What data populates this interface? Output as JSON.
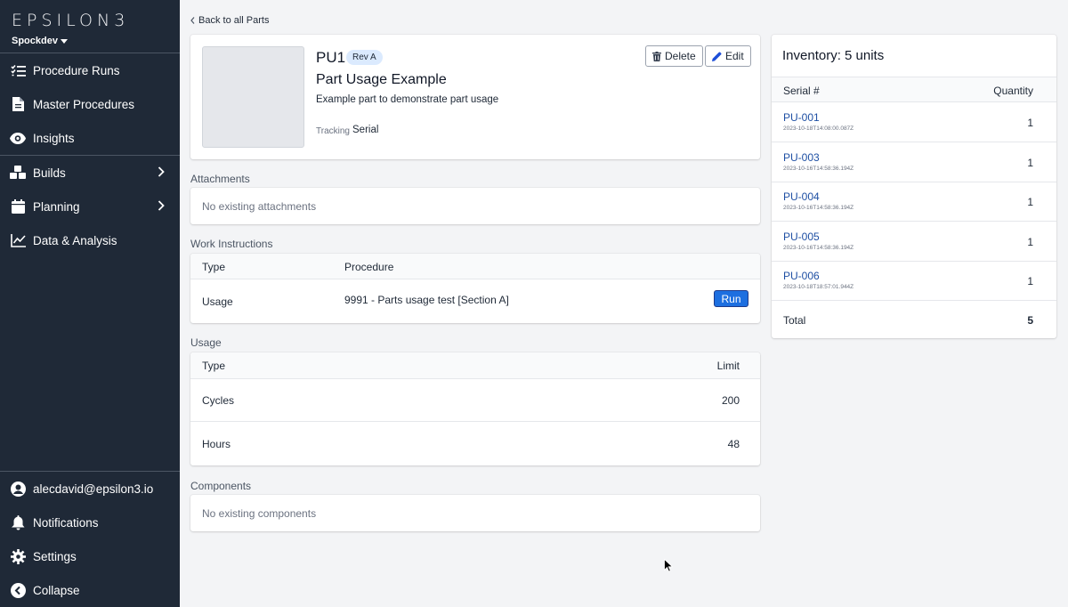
{
  "sidebar": {
    "logo": "EPSILON3",
    "workspace": "Spockdev",
    "items": [
      {
        "label": "Procedure Runs",
        "icon": "checklist-icon"
      },
      {
        "label": "Master Procedures",
        "icon": "document-icon"
      },
      {
        "label": "Insights",
        "icon": "eye-icon"
      },
      {
        "label": "Builds",
        "icon": "cubes-icon"
      },
      {
        "label": "Planning",
        "icon": "calendar-icon"
      },
      {
        "label": "Data & Analysis",
        "icon": "chart-line-icon"
      }
    ],
    "bottom_items": [
      {
        "label": "alecdavid@epsilon3.io",
        "icon": "user-circle-icon"
      },
      {
        "label": "Notifications",
        "icon": "bell-icon"
      },
      {
        "label": "Settings",
        "icon": "gear-icon"
      },
      {
        "label": "Collapse",
        "icon": "arrow-left-circle-icon"
      }
    ]
  },
  "main": {
    "back_link": "Back to all Parts",
    "part": {
      "id": "PU1",
      "revision": "Rev A",
      "name": "Part Usage Example",
      "description": "Example part to demonstrate part usage",
      "tracking_label": "Tracking",
      "tracking_value": "Serial",
      "delete_label": "Delete",
      "edit_label": "Edit"
    },
    "attachments": {
      "label": "Attachments",
      "empty": "No existing attachments"
    },
    "work_instructions": {
      "label": "Work Instructions",
      "columns": [
        "Type",
        "Procedure"
      ],
      "rows": [
        {
          "type": "Usage",
          "procedure": "9991 - Parts usage test [Section A]",
          "action": "Run"
        }
      ]
    },
    "usage": {
      "label": "Usage",
      "columns": [
        "Type",
        "Limit"
      ],
      "rows": [
        {
          "type": "Cycles",
          "limit": "200"
        },
        {
          "type": "Hours",
          "limit": "48"
        }
      ]
    },
    "components": {
      "label": "Components",
      "empty": "No existing components"
    }
  },
  "inventory": {
    "title": "Inventory: 5 units",
    "columns": [
      "Serial #",
      "Quantity"
    ],
    "rows": [
      {
        "serial": "PU-001",
        "date": "2023-10-18T14:08:00.087Z",
        "quantity": "1"
      },
      {
        "serial": "PU-003",
        "date": "2023-10-16T14:58:36.194Z",
        "quantity": "1"
      },
      {
        "serial": "PU-004",
        "date": "2023-10-16T14:58:36.194Z",
        "quantity": "1"
      },
      {
        "serial": "PU-005",
        "date": "2023-10-16T14:58:36.194Z",
        "quantity": "1"
      },
      {
        "serial": "PU-006",
        "date": "2023-10-18T18:57:01.944Z",
        "quantity": "1"
      }
    ],
    "total_label": "Total",
    "total_value": "5"
  },
  "colors": {
    "sidebar_bg": "#1f2937",
    "accent": "#1d6fe0",
    "link": "#1e4fa3",
    "badge_bg": "#dbeafe"
  }
}
